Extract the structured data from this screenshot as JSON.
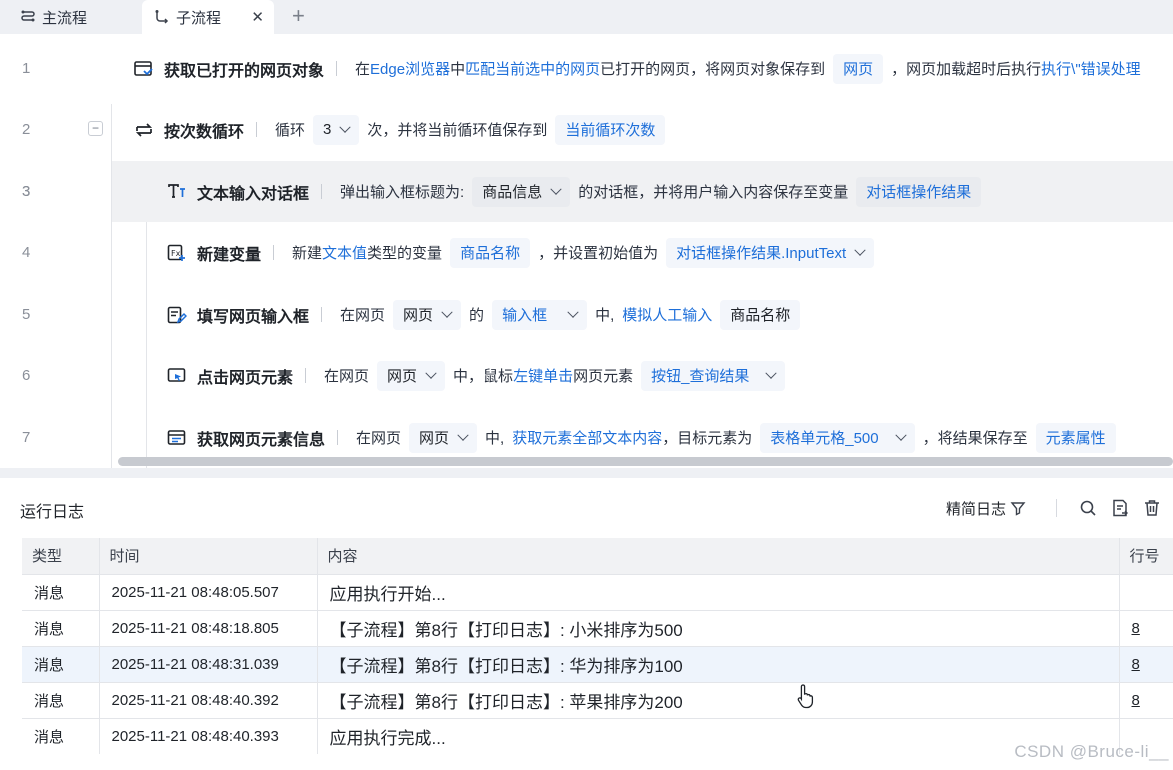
{
  "tabs": {
    "main_label": "主流程",
    "sub_label": "子流程",
    "close": "✕",
    "add": "+"
  },
  "rows": [
    {
      "line": "1",
      "name": "获取已打开的网页对象",
      "p1": "在",
      "l1": "Edge浏览器",
      "p2": "中",
      "l2": "匹配当前选中的网页",
      "p3": "已打开的网页，将网页对象保存到",
      "c1": "网页",
      "p4": "，网页加载超时后执行",
      "l3": "执行\\\"错误处理"
    },
    {
      "line": "2",
      "collapse": "−",
      "name": "按次数循环",
      "p1": "循环",
      "c1": "3",
      "p2": "次，并将当前循环值保存到",
      "c2": "当前循环次数"
    },
    {
      "line": "3",
      "name": "文本输入对话框",
      "p1": "弹出输入框标题为:",
      "c1": "商品信息",
      "p2": "的对话框，并将用户输入内容保存至变量",
      "l1": "对话框操作结果"
    },
    {
      "line": "4",
      "name": "新建变量",
      "p1": "新建",
      "l1": "文本值",
      "p2": "类型的变量",
      "c1": "商品名称",
      "p3": "，并设置初始值为",
      "c2": "对话框操作结果.InputText"
    },
    {
      "line": "5",
      "name": "填写网页输入框",
      "p1": "在网页",
      "c1": "网页",
      "p2": "的",
      "c2": "输入框",
      "p3": "中,",
      "l1": "模拟人工输入",
      "c3": "商品名称"
    },
    {
      "line": "6",
      "name": "点击网页元素",
      "p1": "在网页",
      "c1": "网页",
      "p2": "中，鼠标",
      "l1": "左键单击",
      "p3": "网页元素",
      "c2": "按钮_查询结果"
    },
    {
      "line": "7",
      "name": "获取网页元素信息",
      "p1": "在网页",
      "c1": "网页",
      "p2": "中,",
      "l1": "获取元素全部文本内容",
      "p3": "，目标元素为",
      "c2": "表格单元格_500",
      "p4": "，将结果保存至",
      "c3": "元素属性"
    }
  ],
  "log": {
    "title": "运行日志",
    "filter_label": "精简日志",
    "columns": [
      "类型",
      "时间",
      "内容",
      "行号"
    ],
    "rows": [
      {
        "type": "消息",
        "time": "2025-11-21 08:48:05.507",
        "content": "应用执行开始...",
        "line": ""
      },
      {
        "type": "消息",
        "time": "2025-11-21 08:48:18.805",
        "content": "【子流程】第8行【打印日志】: 小米排序为500",
        "line": "8"
      },
      {
        "type": "消息",
        "time": "2025-11-21 08:48:31.039",
        "content": "【子流程】第8行【打印日志】: 华为排序为100",
        "line": "8"
      },
      {
        "type": "消息",
        "time": "2025-11-21 08:48:40.392",
        "content": "【子流程】第8行【打印日志】: 苹果排序为200",
        "line": "8"
      },
      {
        "type": "消息",
        "time": "2025-11-21 08:48:40.393",
        "content": "应用执行完成...",
        "line": ""
      }
    ]
  },
  "watermark": "CSDN @Bruce-li__",
  "colors": {
    "link": "#1e6fd9",
    "chip_bg": "#f3f6fb",
    "highlight_row": "#f0f1f3",
    "selected_log_row": "#eef4fc"
  }
}
